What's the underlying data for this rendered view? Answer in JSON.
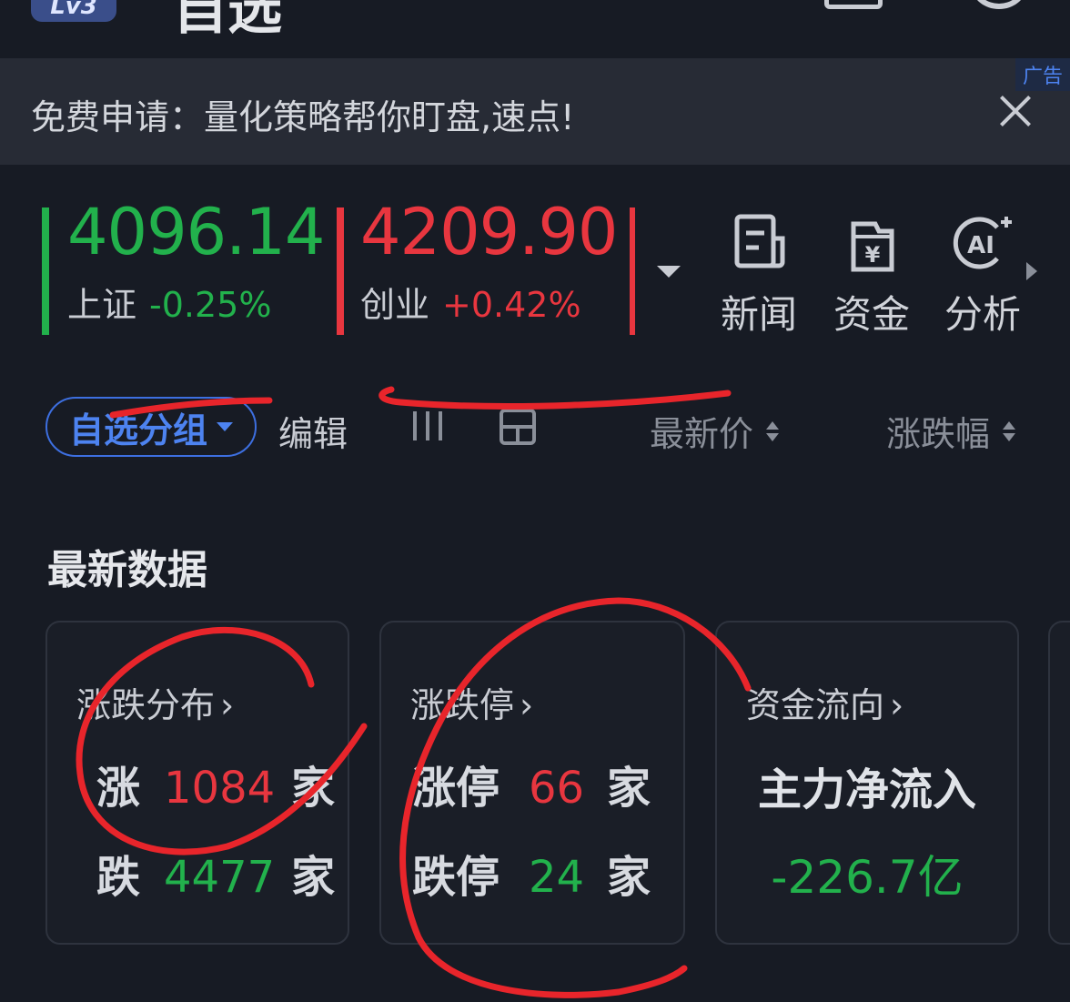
{
  "header": {
    "level_badge": "Lv3",
    "title": "自选"
  },
  "ad": {
    "text": "免费申请：量化策略帮你盯盘,速点!",
    "tag": "广告"
  },
  "indices": [
    {
      "value": "4096.14",
      "name": "上证",
      "change": "-0.25%",
      "direction": "down",
      "color": "#22b14c"
    },
    {
      "value": "4209.90",
      "name": "创业",
      "change": "+0.42%",
      "direction": "up",
      "color": "#e8363f"
    }
  ],
  "tools": [
    {
      "label": "新闻",
      "icon": "news-icon"
    },
    {
      "label": "资金",
      "icon": "fund-icon"
    },
    {
      "label": "分析",
      "icon": "ai-icon"
    }
  ],
  "filter": {
    "group_label": "自选分组",
    "edit_label": "编辑",
    "col_price": "最新价",
    "col_change": "涨跌幅"
  },
  "latest": {
    "title": "最新数据",
    "cards": [
      {
        "title": "涨跌分布",
        "row1": {
          "label": "涨",
          "value": "1084",
          "unit": "家"
        },
        "row2": {
          "label": "跌",
          "value": "4477",
          "unit": "家"
        }
      },
      {
        "title": "涨跌停",
        "row1": {
          "label": "涨停",
          "value": "66",
          "unit": "家"
        },
        "row2": {
          "label": "跌停",
          "value": "24",
          "unit": "家"
        }
      },
      {
        "title": "资金流向",
        "label": "主力净流入",
        "value": "-226.7亿"
      }
    ]
  },
  "colors": {
    "background": "#171b24",
    "up": "#e8363f",
    "down": "#22b14c",
    "accent": "#4d83f0"
  }
}
